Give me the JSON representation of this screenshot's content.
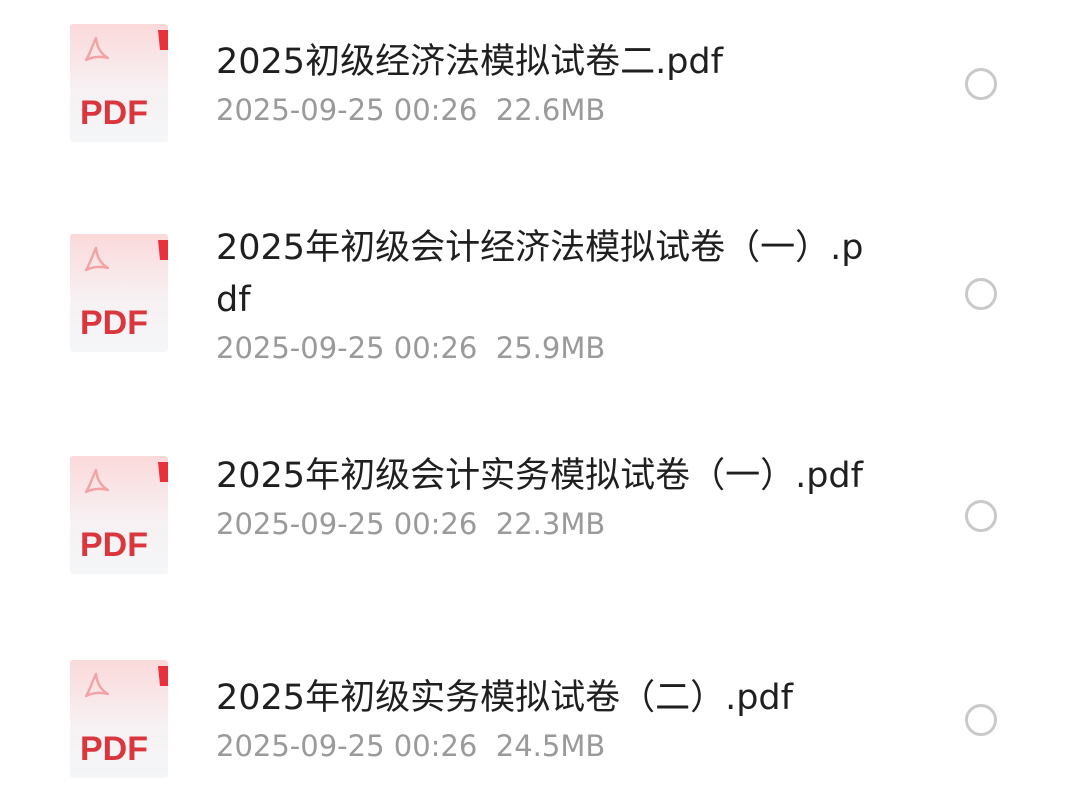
{
  "icon": {
    "name": "pdf-file-icon",
    "label": "PDF",
    "accent_color": "#d9363e",
    "corner_color": "#e8323b"
  },
  "files": [
    {
      "name": "2025初级经济法模拟试卷二.pdf",
      "date": "2025-09-25 00:26",
      "size": "22.6MB"
    },
    {
      "name": "2025年初级会计经济法模拟试卷（一）.pdf",
      "date": "2025-09-25 00:26",
      "size": "25.9MB"
    },
    {
      "name": "2025年初级会计实务模拟试卷（一）.pdf",
      "date": "2025-09-25 00:26",
      "size": "22.3MB"
    },
    {
      "name": "2025年初级实务模拟试卷（二）.pdf",
      "date": "2025-09-25 00:26",
      "size": "24.5MB"
    }
  ]
}
